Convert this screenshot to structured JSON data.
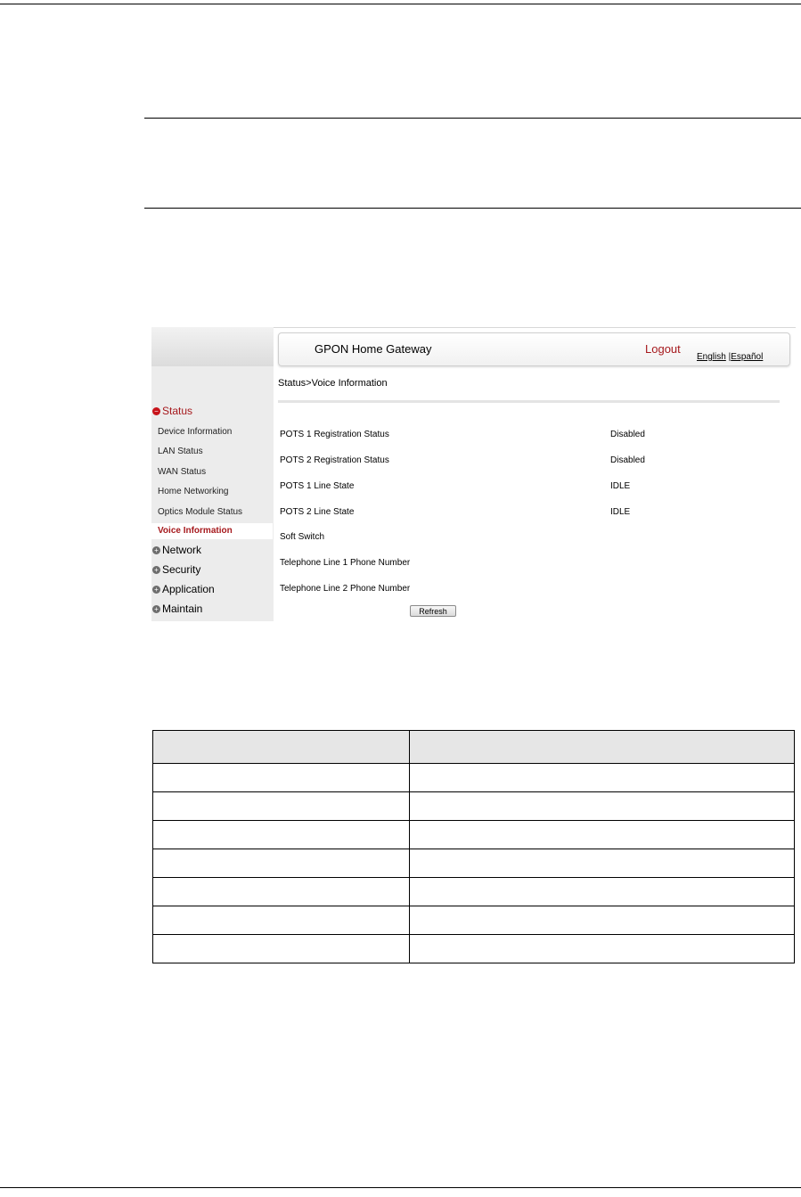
{
  "app": {
    "title": "GPON Home Gateway",
    "logout_label": "Logout"
  },
  "language": {
    "english": "English",
    "separator": " |",
    "spanish": "Español"
  },
  "breadcrumb": "Status>Voice Information",
  "sidebar": {
    "sections": [
      {
        "label": "Status",
        "expanded": true
      },
      {
        "label": "Network",
        "expanded": false
      },
      {
        "label": "Security",
        "expanded": false
      },
      {
        "label": "Application",
        "expanded": false
      },
      {
        "label": "Maintain",
        "expanded": false
      }
    ],
    "status_items": [
      {
        "label": "Device Information"
      },
      {
        "label": "LAN Status"
      },
      {
        "label": "WAN Status"
      },
      {
        "label": "Home Networking"
      },
      {
        "label": "Optics Module Status"
      },
      {
        "label": "Voice Information",
        "active": true
      }
    ]
  },
  "voice_info": {
    "rows": [
      {
        "label": "POTS 1 Registration Status",
        "value": "Disabled"
      },
      {
        "label": "POTS 2 Registration Status",
        "value": "Disabled"
      },
      {
        "label": "POTS 1 Line State",
        "value": "IDLE"
      },
      {
        "label": "POTS 2 Line State",
        "value": "IDLE"
      },
      {
        "label": "Soft Switch",
        "value": ""
      },
      {
        "label": "Telephone Line 1 Phone Number",
        "value": ""
      },
      {
        "label": "Telephone Line 2 Phone Number",
        "value": ""
      }
    ],
    "refresh_label": "Refresh"
  },
  "colors": {
    "accent": "#a6191d",
    "sidebar_bg": "#ececec"
  }
}
